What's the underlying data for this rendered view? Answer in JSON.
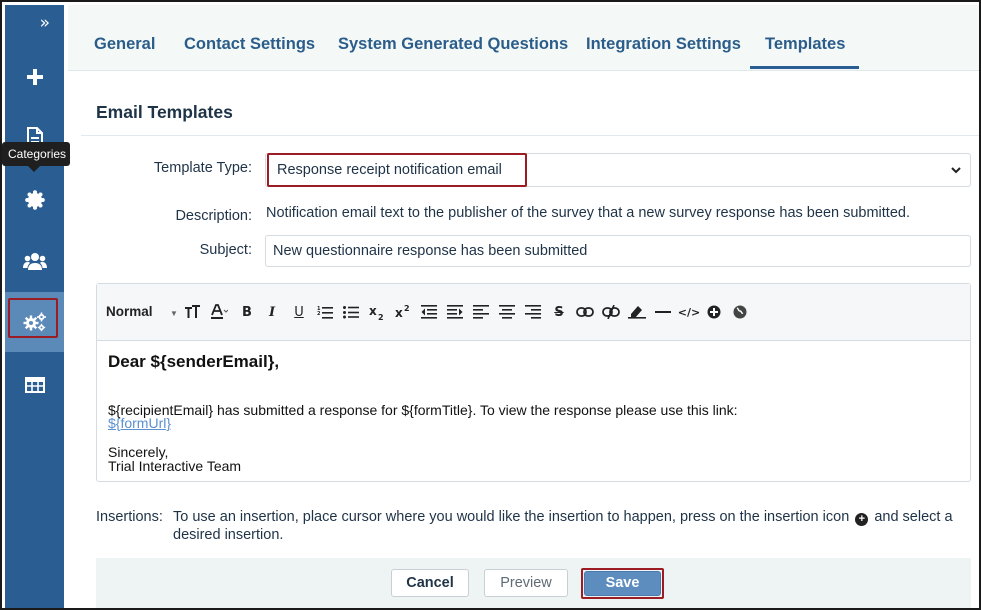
{
  "sidebar": {
    "collapse_icon": "double-chevron-right-icon",
    "items": [
      {
        "icon": "plus-icon"
      },
      {
        "icon": "document-icon"
      },
      {
        "icon": "badge-icon",
        "tooltip": "Categories"
      },
      {
        "icon": "users-icon"
      },
      {
        "icon": "settings-gears-icon",
        "active": true
      },
      {
        "icon": "table-icon"
      }
    ],
    "tooltip": "Categories"
  },
  "tabs": [
    {
      "label": "General"
    },
    {
      "label": "Contact Settings"
    },
    {
      "label": "System Generated Questions"
    },
    {
      "label": "Integration Settings"
    },
    {
      "label": "Templates",
      "active": true
    }
  ],
  "panel": {
    "title": "Email Templates",
    "template_type_label": "Template Type:",
    "template_type_value": "Response receipt notification email",
    "description_label": "Description:",
    "description_text": "Notification email text to the publisher of the survey that a new survey response has been submitted.",
    "subject_label": "Subject:",
    "subject_value": "New questionnaire response has been submitted"
  },
  "editor": {
    "toolbar": {
      "format_label": "Normal",
      "buttons": [
        "font-size-icon",
        "font-color-icon",
        "bold-icon",
        "italic-icon",
        "underline-icon",
        "ordered-list-icon",
        "bullet-list-icon",
        "subscript-icon",
        "superscript-icon",
        "outdent-icon",
        "indent-icon",
        "align-left-icon",
        "align-center-icon",
        "align-right-icon",
        "strikethrough-icon",
        "link-icon",
        "unlink-icon",
        "clear-format-icon",
        "horizontal-rule-icon",
        "code-view-icon",
        "insertion-plus-icon",
        "globe-icon"
      ],
      "sub_label": "x2",
      "sup_label": "x2"
    },
    "body": {
      "greeting": "Dear ${senderEmail},",
      "line1": "${recipientEmail} has submitted a response for ${formTitle}. To view the response please use this link:",
      "link": "${formUrl}",
      "closing": "Sincerely,",
      "signature": "Trial Interactive Team"
    }
  },
  "insertions": {
    "label": "Insertions:",
    "text_before": "To use an insertion, place cursor where you would like the insertion to happen, press on the insertion icon",
    "text_after": "and select a desired insertion."
  },
  "footer": {
    "cancel": "Cancel",
    "preview": "Preview",
    "save": "Save"
  },
  "colors": {
    "sidebar": "#2a5e93",
    "accent": "#2c5d8a",
    "highlight_box": "#9b1c22",
    "save_button": "#5d8dbf",
    "link": "#5a8fd0"
  }
}
